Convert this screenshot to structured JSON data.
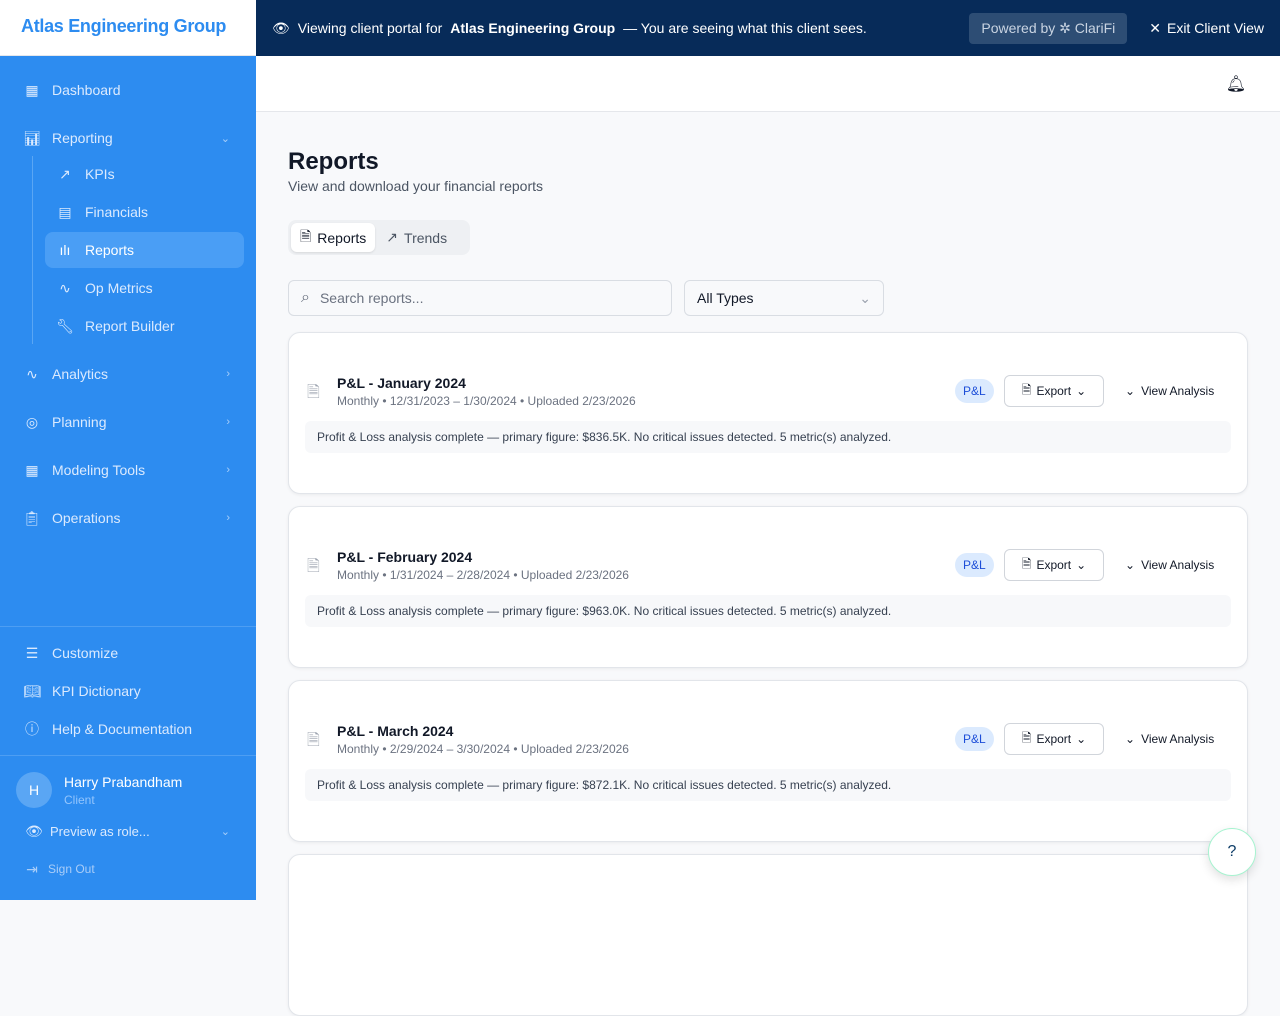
{
  "brand": "Atlas Engineering Group",
  "banner": {
    "prefix": "Viewing client portal for",
    "client": "Atlas Engineering Group",
    "suffix": "— You are seeing what this client sees.",
    "powered": "Powered by ✲ ClariFi",
    "exit": "Exit Client View"
  },
  "sidebar": {
    "dashboard": "Dashboard",
    "reporting": "Reporting",
    "sub": [
      "KPIs",
      "Financials",
      "Reports",
      "Op Metrics",
      "Report Builder"
    ],
    "analytics": "Analytics",
    "planning": "Planning",
    "modeling": "Modeling Tools",
    "operations": "Operations",
    "customize": "Customize",
    "kpi_dict": "KPI Dictionary",
    "help": "Help & Documentation",
    "user": {
      "initial": "H",
      "name": "Harry Prabandham",
      "role": "Client"
    },
    "preview": "Preview as role...",
    "signout": "Sign Out"
  },
  "page": {
    "title": "Reports",
    "subtitle": "View and download your financial reports",
    "tabs": [
      "Reports",
      "Trends"
    ],
    "search_placeholder": "Search reports...",
    "type_filter": "All Types"
  },
  "reports": [
    {
      "title": "P&L - January 2024",
      "meta": "Monthly • 12/31/2023 – 1/30/2024 • Uploaded 2/23/2026",
      "badge": "P&L",
      "summary": "Profit & Loss analysis complete — primary figure: $836.5K. No critical issues detected. 5 metric(s) analyzed."
    },
    {
      "title": "P&L - February 2024",
      "meta": "Monthly • 1/31/2024 – 2/28/2024 • Uploaded 2/23/2026",
      "badge": "P&L",
      "summary": "Profit & Loss analysis complete — primary figure: $963.0K. No critical issues detected. 5 metric(s) analyzed."
    },
    {
      "title": "P&L - March 2024",
      "meta": "Monthly • 2/29/2024 – 3/30/2024 • Uploaded 2/23/2026",
      "badge": "P&L",
      "summary": "Profit & Loss analysis complete — primary figure: $872.1K. No critical issues detected. 5 metric(s) analyzed."
    }
  ],
  "actions": {
    "export": "Export",
    "view": "View Analysis"
  }
}
